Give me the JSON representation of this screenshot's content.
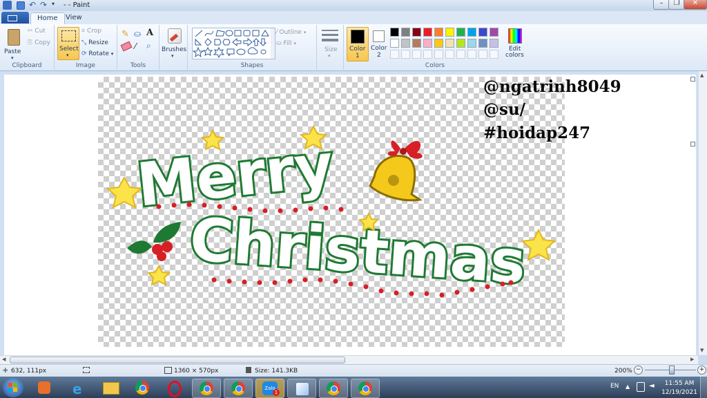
{
  "window": {
    "title": "- - Paint"
  },
  "tabs": {
    "home": "Home",
    "view": "View"
  },
  "clipboard": {
    "paste": "Paste",
    "cut": "Cut",
    "copy": "Copy",
    "label": "Clipboard"
  },
  "image": {
    "select": "Select",
    "crop": "Crop",
    "resize": "Resize",
    "rotate": "Rotate",
    "label": "Image"
  },
  "tools": {
    "label": "Tools"
  },
  "brushes": {
    "label": "Brushes"
  },
  "shapes": {
    "outline": "Outline",
    "fill": "Fill",
    "label": "Shapes"
  },
  "size": {
    "label": "Size"
  },
  "colors": {
    "color1_line1": "Color",
    "color1_line2": "1",
    "color2_line1": "Color",
    "color2_line2": "2",
    "edit_line1": "Edit",
    "edit_line2": "colors",
    "label": "Colors",
    "color1_value": "#000000",
    "color2_value": "#ffffff",
    "palette_row1": [
      "#000000",
      "#7f7f7f",
      "#880015",
      "#ed1c24",
      "#ff7f27",
      "#fff200",
      "#22b14c",
      "#00a2e8",
      "#3f48cc",
      "#a349a4"
    ],
    "palette_row2": [
      "#ffffff",
      "#c3c3c3",
      "#b97a57",
      "#ffaec9",
      "#ffc90e",
      "#efe4b0",
      "#b5e61d",
      "#99d9ea",
      "#7092be",
      "#c8bfe7"
    ]
  },
  "canvas_notes": [
    "@ngatrinh8049",
    "@su/",
    "#hoidap247"
  ],
  "artwork": {
    "line1": "Merry",
    "line2": "Christmas"
  },
  "status": {
    "cursor": "632, 111px",
    "dimensions": "1360 × 570px",
    "size": "Size: 141.3KB",
    "zoom": "200%"
  },
  "taskbar": {
    "language": "EN",
    "time": "11:55 AM",
    "date": "12/19/2021",
    "zalo": "Zalo",
    "zalo_badge": "1"
  }
}
